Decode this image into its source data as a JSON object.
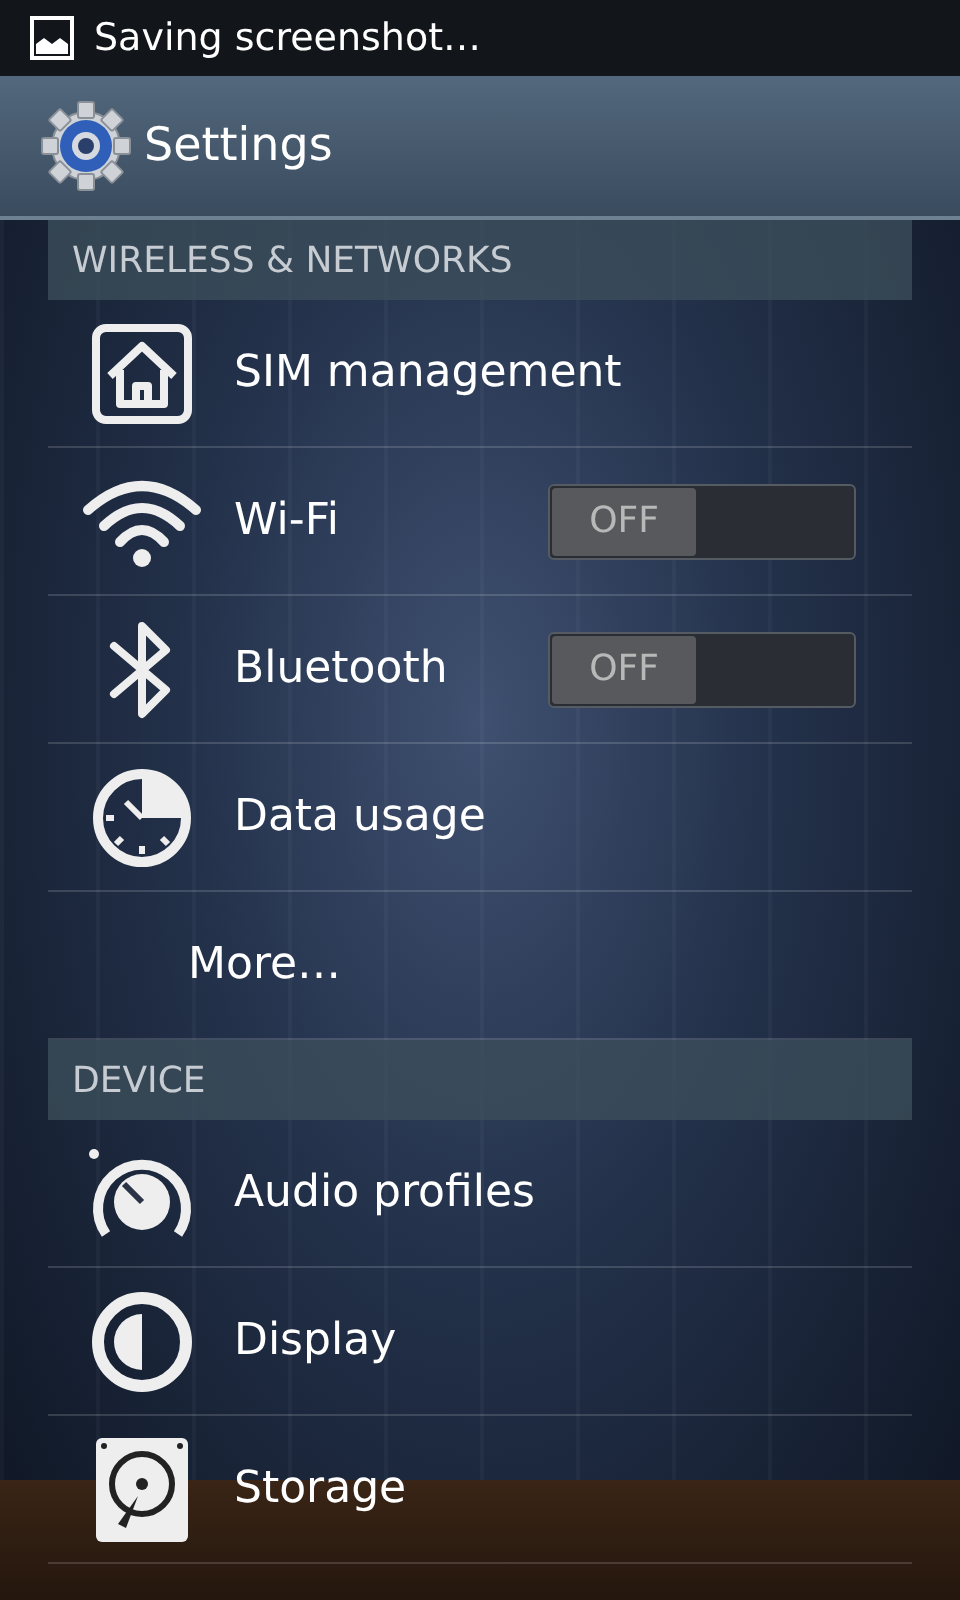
{
  "status_bar": {
    "notification": "Saving screenshot…"
  },
  "title_bar": {
    "title": "Settings"
  },
  "sections": [
    {
      "header": "WIRELESS & NETWORKS",
      "items": [
        {
          "label": "SIM management",
          "kind": "plain"
        },
        {
          "label": "Wi-Fi",
          "kind": "toggle",
          "on": false,
          "toggle_text": "OFF"
        },
        {
          "label": "Bluetooth",
          "kind": "toggle",
          "on": false,
          "toggle_text": "OFF"
        },
        {
          "label": "Data usage",
          "kind": "plain"
        },
        {
          "label": "More…",
          "kind": "indented"
        }
      ]
    },
    {
      "header": "DEVICE",
      "items": [
        {
          "label": "Audio profiles",
          "kind": "plain"
        },
        {
          "label": "Display",
          "kind": "plain"
        },
        {
          "label": "Storage",
          "kind": "plain"
        }
      ]
    }
  ]
}
